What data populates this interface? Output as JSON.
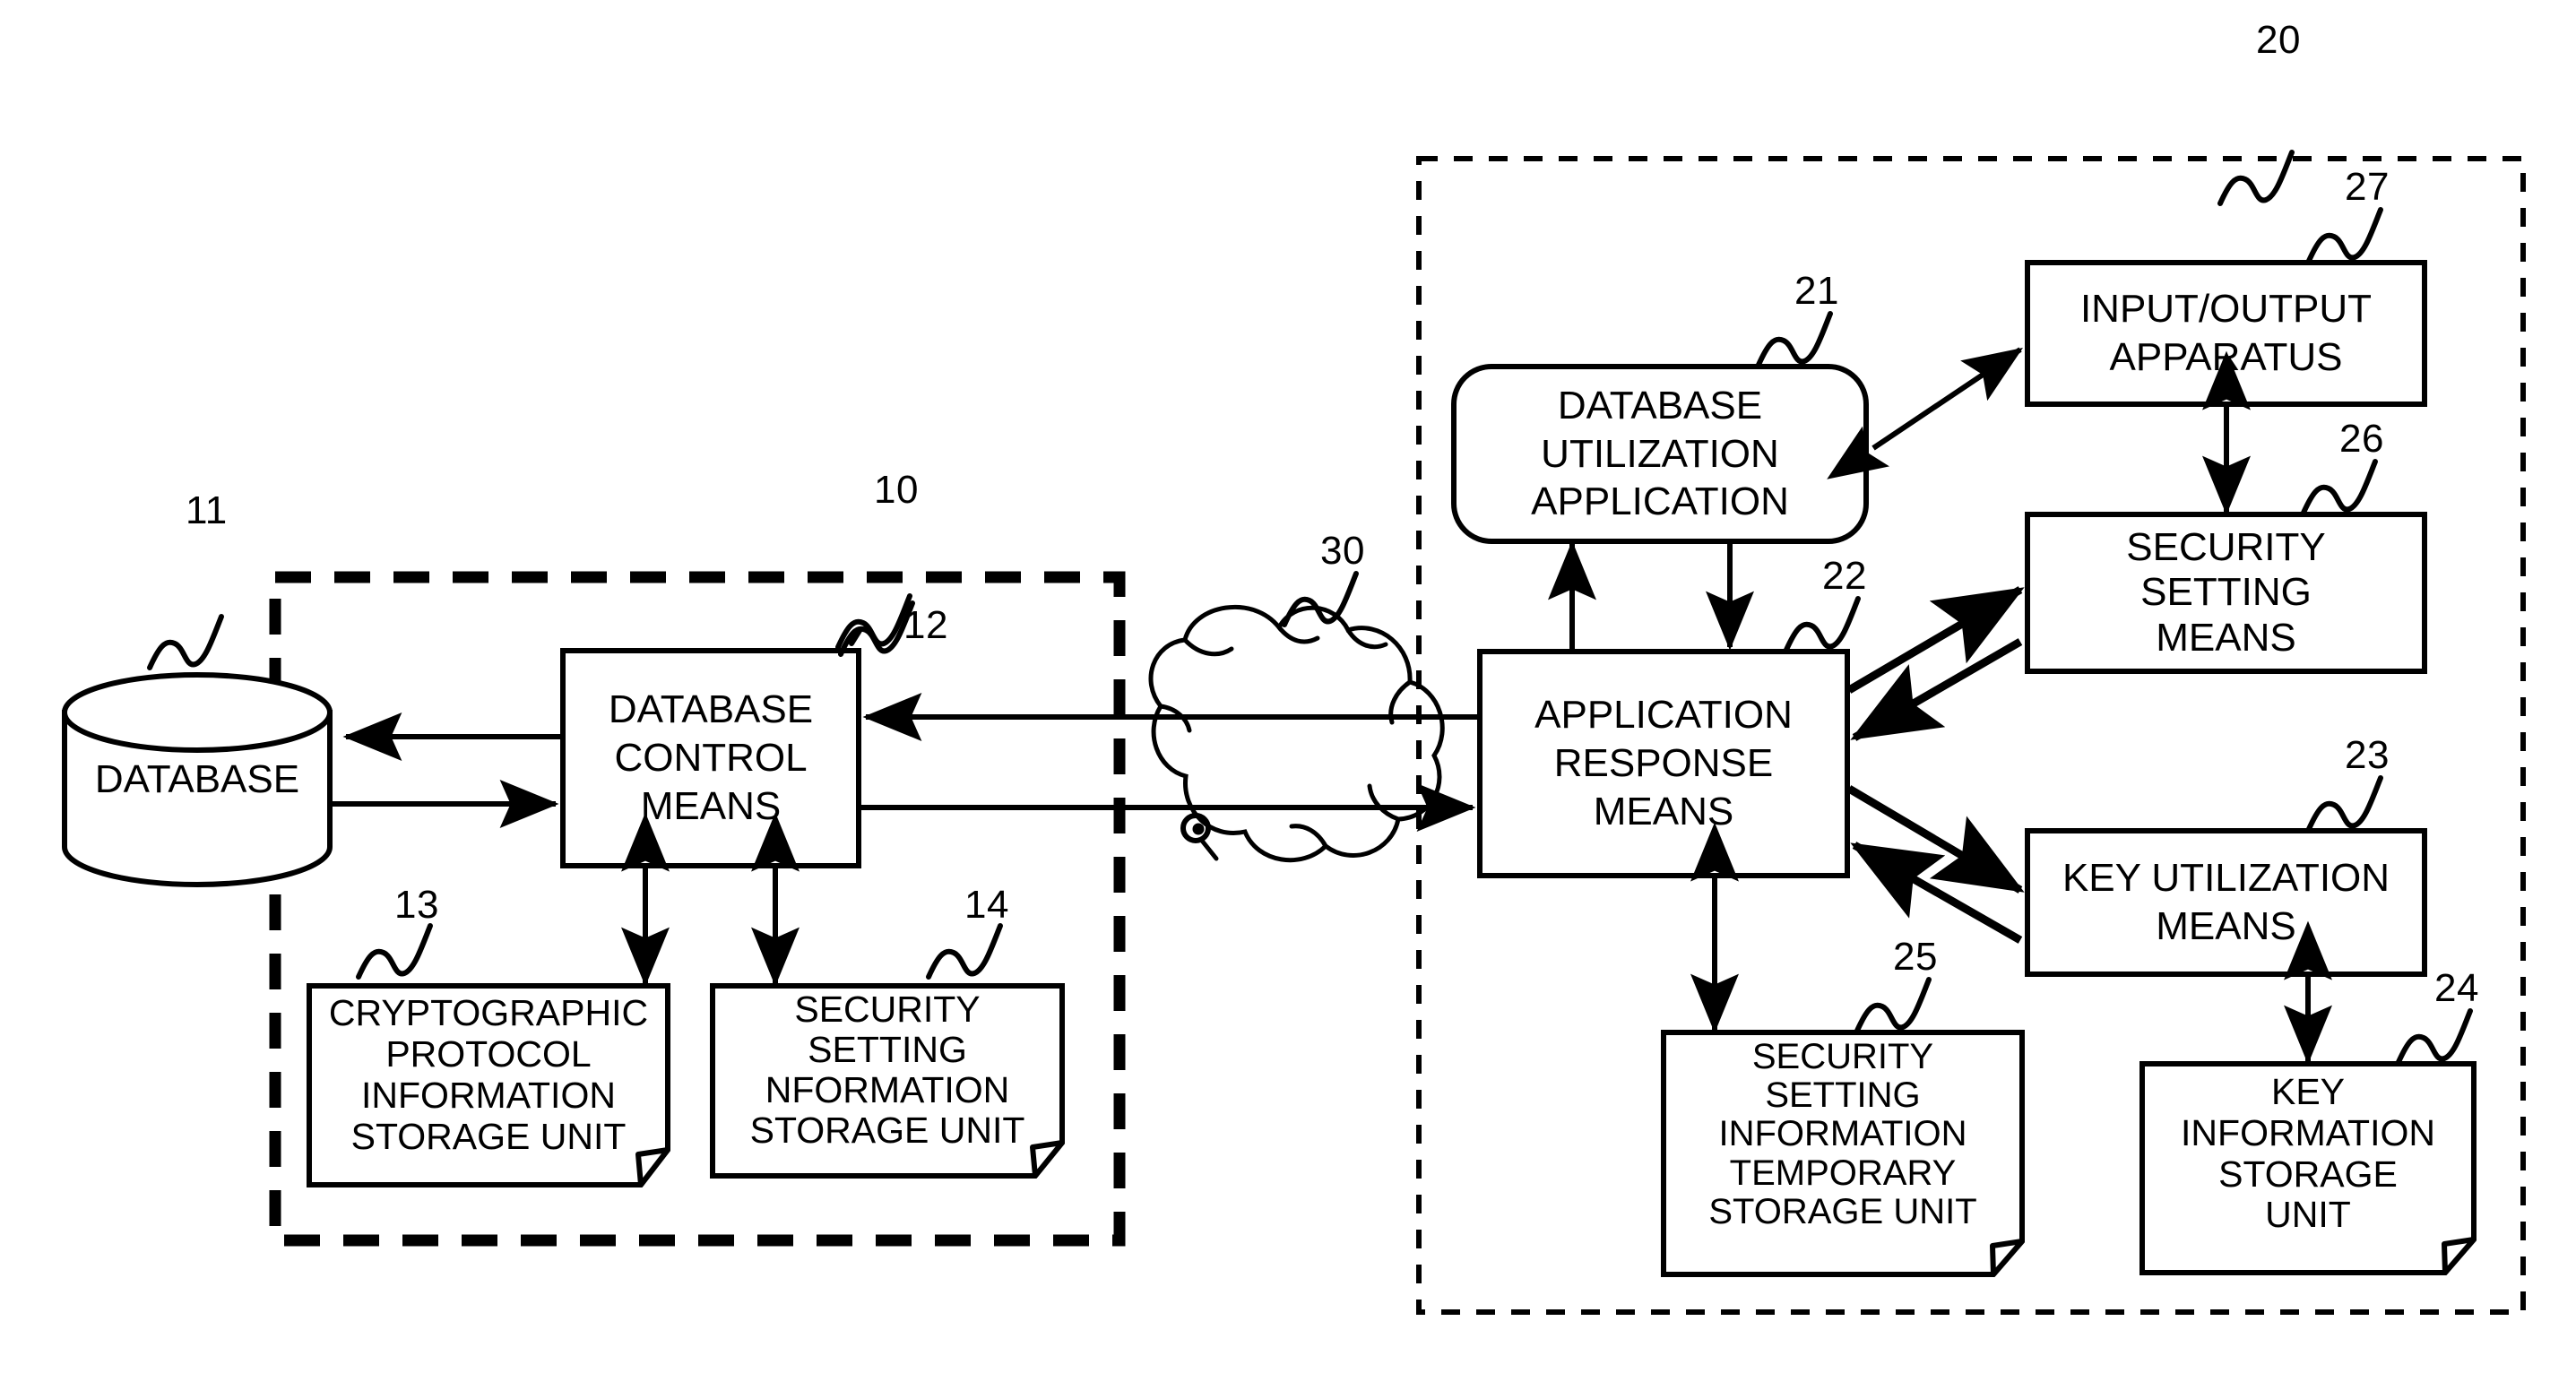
{
  "figure": {
    "title": "Database security system block diagram",
    "stroke_color": "#000000",
    "background_color": "#ffffff"
  },
  "groups": [
    {
      "id": "server-side",
      "ref": "10",
      "style": "dashed-thick"
    },
    {
      "id": "client-side",
      "ref": "20",
      "style": "dashed-thin"
    }
  ],
  "nodes": {
    "database": {
      "ref": "11",
      "label": "DATABASE",
      "shape": "cylinder"
    },
    "database_control_means": {
      "ref": "12",
      "label": "DATABASE\nCONTROL\nMEANS",
      "shape": "rect"
    },
    "cryptographic_protocol_storage": {
      "ref": "13",
      "label": "CRYPTOGRAPHIC\nPROTOCOL\nINFORMATION\nSTORAGE UNIT",
      "shape": "document"
    },
    "security_setting_information_storage": {
      "ref": "14",
      "label": "SECURITY\nSETTING\nNFORMATION\nSTORAGE UNIT",
      "shape": "document"
    },
    "network": {
      "ref": "30",
      "label": "",
      "shape": "cloud"
    },
    "database_utilization_application": {
      "ref": "21",
      "label": "DATABASE\nUTILIZATION\nAPPLICATION",
      "shape": "rounded-rect"
    },
    "application_response_means": {
      "ref": "22",
      "label": "APPLICATION\nRESPONSE\nMEANS",
      "shape": "rect"
    },
    "key_utilization_means": {
      "ref": "23",
      "label": "KEY UTILIZATION\nMEANS",
      "shape": "rect"
    },
    "key_information_storage_unit": {
      "ref": "24",
      "label": "KEY\nINFORMATION\nSTORAGE\nUNIT",
      "shape": "document"
    },
    "security_setting_temporary_storage": {
      "ref": "25",
      "label": "SECURITY\nSETTING\nINFORMATION\nTEMPORARY\nSTORAGE UNIT",
      "shape": "document"
    },
    "security_setting_means": {
      "ref": "26",
      "label": "SECURITY\nSETTING\nMEANS",
      "shape": "rect"
    },
    "input_output_apparatus": {
      "ref": "27",
      "label": "INPUT/OUTPUT\nAPPARATUS",
      "shape": "rect"
    }
  },
  "reference_numerals": [
    {
      "id": "ref-10",
      "text": "10"
    },
    {
      "id": "ref-11",
      "text": "11"
    },
    {
      "id": "ref-12",
      "text": "12"
    },
    {
      "id": "ref-13",
      "text": "13"
    },
    {
      "id": "ref-14",
      "text": "14"
    },
    {
      "id": "ref-20",
      "text": "20"
    },
    {
      "id": "ref-21",
      "text": "21"
    },
    {
      "id": "ref-22",
      "text": "22"
    },
    {
      "id": "ref-23",
      "text": "23"
    },
    {
      "id": "ref-24",
      "text": "24"
    },
    {
      "id": "ref-25",
      "text": "25"
    },
    {
      "id": "ref-26",
      "text": "26"
    },
    {
      "id": "ref-27",
      "text": "27"
    },
    {
      "id": "ref-30",
      "text": "30"
    }
  ],
  "connections": [
    {
      "from": "database_control_means",
      "to": "database",
      "direction": "one-way"
    },
    {
      "from": "database",
      "to": "database_control_means",
      "direction": "one-way"
    },
    {
      "from": "database_control_means",
      "to": "cryptographic_protocol_storage",
      "direction": "two-way"
    },
    {
      "from": "database_control_means",
      "to": "security_setting_information_storage",
      "direction": "two-way"
    },
    {
      "from": "application_response_means",
      "to": "database_control_means",
      "direction": "one-way",
      "via": "network"
    },
    {
      "from": "database_control_means",
      "to": "application_response_means",
      "direction": "one-way",
      "via": "network"
    },
    {
      "from": "application_response_means",
      "to": "database_utilization_application",
      "direction": "one-way"
    },
    {
      "from": "database_utilization_application",
      "to": "application_response_means",
      "direction": "one-way"
    },
    {
      "from": "database_utilization_application",
      "to": "input_output_apparatus",
      "direction": "two-way"
    },
    {
      "from": "input_output_apparatus",
      "to": "security_setting_means",
      "direction": "two-way"
    },
    {
      "from": "application_response_means",
      "to": "security_setting_means",
      "direction": "one-way"
    },
    {
      "from": "security_setting_means",
      "to": "application_response_means",
      "direction": "one-way"
    },
    {
      "from": "application_response_means",
      "to": "key_utilization_means",
      "direction": "one-way"
    },
    {
      "from": "key_utilization_means",
      "to": "application_response_means",
      "direction": "one-way"
    },
    {
      "from": "key_utilization_means",
      "to": "key_information_storage_unit",
      "direction": "two-way"
    },
    {
      "from": "application_response_means",
      "to": "security_setting_temporary_storage",
      "direction": "two-way"
    }
  ]
}
